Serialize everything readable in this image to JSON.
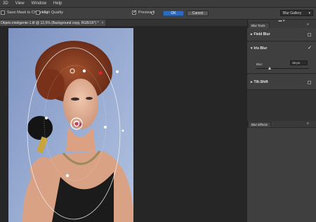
{
  "menu": [
    "3D",
    "View",
    "Window",
    "Help"
  ],
  "options": {
    "save_mask": "Save Mask to Channels",
    "high_quality": "High Quality",
    "preview": "Preview",
    "ok": "OK",
    "cancel": "Cancel",
    "gallery": "Blur Gallery"
  },
  "document": {
    "tab_title": "Objeto inteligente-1.tif @ 12,5% (Background copy, RGB/16*) *",
    "close": "×"
  },
  "panels": {
    "blur_tools_tab": "Blur Tools",
    "field_blur": "Field Blur",
    "iris_blur": "Iris Blur",
    "blur_label": "Blur:",
    "blur_value": "15 px",
    "tilt_shift": "Tilt-Shift",
    "blur_effects_tab": "Blur Effects"
  },
  "colors": {
    "accent": "#2d6bc0",
    "panel": "#3f3f3f"
  }
}
